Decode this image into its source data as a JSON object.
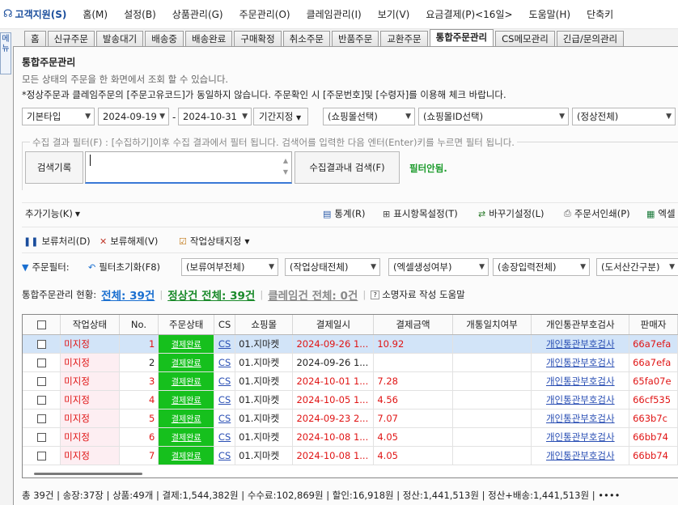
{
  "menubar": [
    "고객지원(S)",
    "홈(M)",
    "설정(B)",
    "상품관리(G)",
    "주문관리(O)",
    "클레임관리(I)",
    "보기(V)",
    "요금결제(P)<16일>",
    "도움말(H)",
    "단축키"
  ],
  "side_button": "메뉴",
  "tabs": [
    "홈",
    "신규주문",
    "발송대기",
    "배송중",
    "배송완료",
    "구매확정",
    "취소주문",
    "반품주문",
    "교환주문",
    "통합주문관리",
    "CS메모관리",
    "긴급/문의관리"
  ],
  "page": {
    "title": "통합주문관리",
    "desc1": "모든 상태의 주문을 한 화면에서 조회 할 수 있습니다.",
    "desc2": "*정상주문과 클레임주문의 [주문고유코드]가 동일하지 않습니다. 주문확인 시 [주문번호]및 [수령자]를 이용해 체크 바랍니다."
  },
  "filters": {
    "date_type": "기본타입",
    "date_from": "2024-09-19",
    "date_to": "2024-10-31",
    "period_btn": "기간지정",
    "mall_select": "(쇼핑몰선택)",
    "mall_id_select": "(쇼핑몰ID선택)",
    "status_select": "(정상전체)"
  },
  "collect_filter": {
    "hint": "수집 결과 필터(F) : [수집하기]이후 수집 결과에서 필터 됩니다. 검색어를 입력한 다음 엔터(Enter)키를 누르면 필터 됩니다.",
    "history_btn": "검색기록",
    "search_value": "",
    "inner_search_btn": "수집결과내 검색(F)",
    "filter_state": "필터안됨."
  },
  "toolbar1": {
    "extra": "추가기능(K)",
    "stats": "통계(R)",
    "display": "표시항목설정(T)",
    "shortcut": "바꾸기설정(L)",
    "print": "주문서인쇄(P)",
    "excel": "엑셀"
  },
  "toolbar2": {
    "hold": "보류처리(D)",
    "release": "보류해제(V)",
    "workstate": "작업상태지정"
  },
  "toolbar3": {
    "label": "주문필터:",
    "reset": "필터초기화(F8)",
    "opts": [
      "(보류여부전체)",
      "(작업상태전체)",
      "(엑셀생성여부)",
      "(송장입력전체)",
      "(도서산간구분)"
    ]
  },
  "status": {
    "prefix": "통합주문관리 현황:",
    "total": "전체: 39건",
    "normal": "정상건 전체:  39건",
    "claim": "클레임건 전체: 0건",
    "help": "소명자료 작성 도움말"
  },
  "grid": {
    "columns": [
      "",
      "작업상태",
      "No.",
      "주문상태",
      "CS",
      "쇼핑몰",
      "결제일시",
      "결제금액",
      "개통일치여부",
      "개인통관부호검사",
      "판매자"
    ],
    "rows": [
      {
        "state": "미지정",
        "no": "1",
        "ostate": "결제완료",
        "cs": "CS",
        "mall": "01.지마켓",
        "date": "2024-09-26 1...",
        "amount": "10.92",
        "match": "",
        "check": "개인통관부호검사",
        "seller": "66a7efa",
        "red": true,
        "selected": true
      },
      {
        "state": "미지정",
        "no": "2",
        "ostate": "결제완료",
        "cs": "CS",
        "mall": "01.지마켓",
        "date": "2024-09-26 1...",
        "amount": "",
        "match": "",
        "check": "개인통관부호검사",
        "seller": "66a7efa",
        "red": false,
        "selected": false
      },
      {
        "state": "미지정",
        "no": "3",
        "ostate": "결제완료",
        "cs": "CS",
        "mall": "01.지마켓",
        "date": "2024-10-01 1...",
        "amount": "7.28",
        "match": "",
        "check": "개인통관부호검사",
        "seller": "65fa07e",
        "red": true,
        "selected": false
      },
      {
        "state": "미지정",
        "no": "4",
        "ostate": "결제완료",
        "cs": "CS",
        "mall": "01.지마켓",
        "date": "2024-10-05 1...",
        "amount": "4.56",
        "match": "",
        "check": "개인통관부호검사",
        "seller": "66cf535",
        "red": true,
        "selected": false
      },
      {
        "state": "미지정",
        "no": "5",
        "ostate": "결제완료",
        "cs": "CS",
        "mall": "01.지마켓",
        "date": "2024-09-23 2...",
        "amount": "7.07",
        "match": "",
        "check": "개인통관부호검사",
        "seller": "663b7c",
        "red": true,
        "selected": false
      },
      {
        "state": "미지정",
        "no": "6",
        "ostate": "결제완료",
        "cs": "CS",
        "mall": "01.지마켓",
        "date": "2024-10-08 1...",
        "amount": "4.05",
        "match": "",
        "check": "개인통관부호검사",
        "seller": "66bb74",
        "red": true,
        "selected": false
      },
      {
        "state": "미지정",
        "no": "7",
        "ostate": "결제완료",
        "cs": "CS",
        "mall": "01.지마켓",
        "date": "2024-10-08 1...",
        "amount": "4.05",
        "match": "",
        "check": "개인통관부호검사",
        "seller": "66bb74",
        "red": true,
        "selected": false
      }
    ]
  },
  "footer": "총 39건 | 송장:37장 | 상품:49개 | 결제:1,544,382원 | 수수료:102,869원 | 할인:16,918원 | 정산:1,441,513원 | 정산+배송:1,441,513원 | ••••",
  "colors": {
    "accent": "#1a4d9c",
    "green": "#16c01d",
    "red": "#e01515",
    "link": "#2a4fb4"
  }
}
